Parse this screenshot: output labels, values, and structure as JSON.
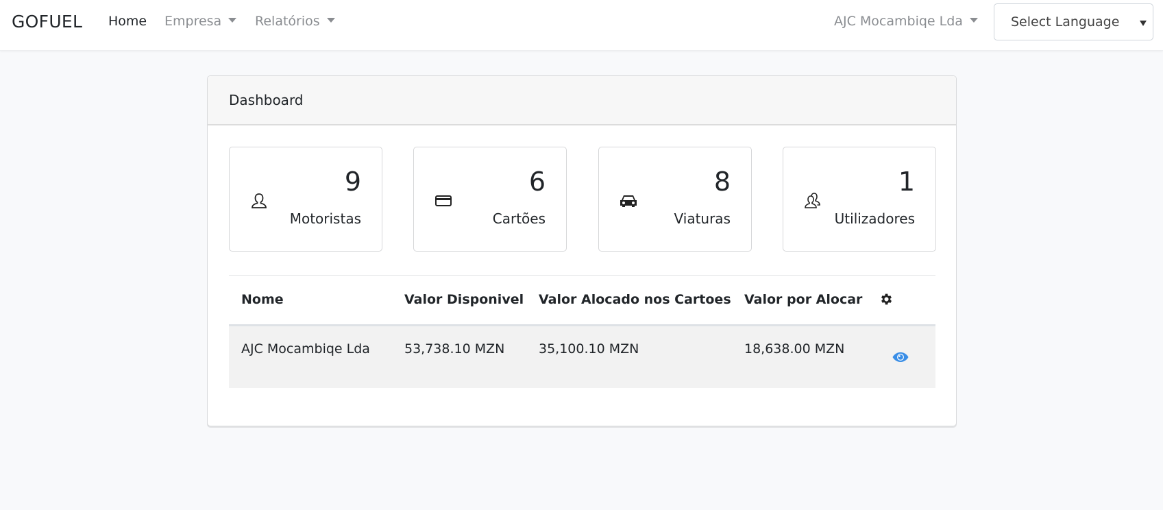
{
  "navbar": {
    "brand": "GOFUEL",
    "links": [
      {
        "label": "Home",
        "active": true,
        "dropdown": false
      },
      {
        "label": "Empresa",
        "active": false,
        "dropdown": true
      },
      {
        "label": "Relatórios",
        "active": false,
        "dropdown": true
      }
    ],
    "company_menu": "AJC Mocambiqe Lda",
    "language_select": {
      "selected": "Select Language"
    }
  },
  "dashboard": {
    "title": "Dashboard",
    "stats": [
      {
        "icon": "user-icon",
        "value": "9",
        "label": "Motoristas"
      },
      {
        "icon": "credit-card-icon",
        "value": "6",
        "label": "Cartões"
      },
      {
        "icon": "car-icon",
        "value": "8",
        "label": "Viaturas"
      },
      {
        "icon": "users-icon",
        "value": "1",
        "label": "Utilizadores"
      }
    ],
    "table": {
      "columns": [
        "Nome",
        "Valor Disponivel",
        "Valor Alocado nos Cartoes",
        "Valor por Alocar"
      ],
      "settings_icon": "gear-icon",
      "rows": [
        {
          "nome": "AJC Mocambiqe Lda",
          "disponivel": "53,738.10 MZN",
          "alocado": "35,100.10 MZN",
          "por_alocar": "18,638.00 MZN",
          "action_icon": "eye-icon"
        }
      ]
    }
  },
  "colors": {
    "accent": "#3a8ee6",
    "nav_inactive": "#8a8d91",
    "page_bg": "#f8f9fb"
  }
}
